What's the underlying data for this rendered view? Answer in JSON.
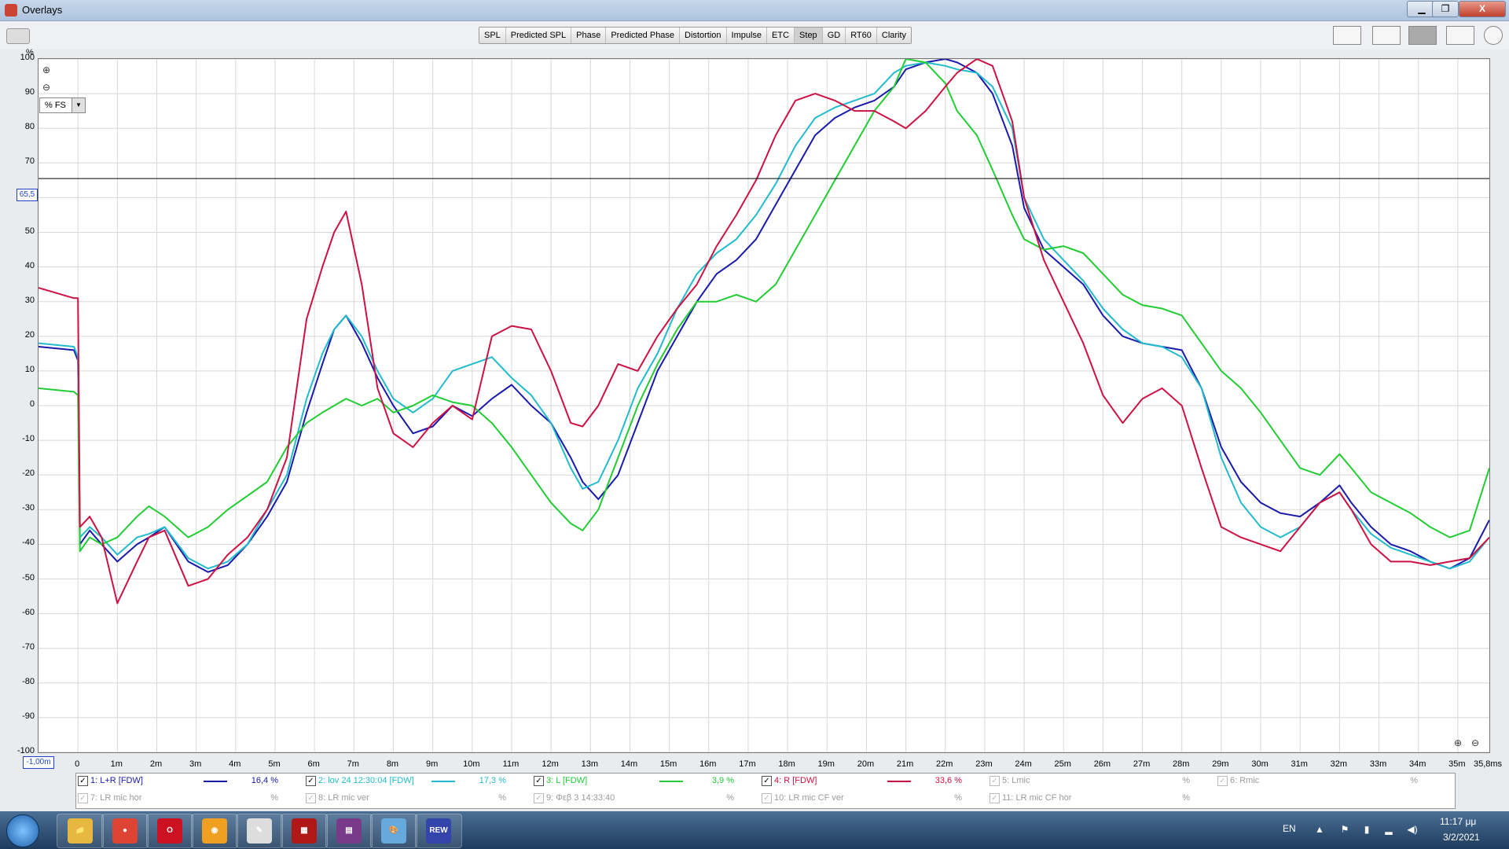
{
  "window": {
    "title": "Overlays",
    "minimize": "▁",
    "maximize": "❐",
    "close": "X"
  },
  "tabs": [
    {
      "label": "SPL",
      "active": false
    },
    {
      "label": "Predicted SPL",
      "active": false
    },
    {
      "label": "Phase",
      "active": false
    },
    {
      "label": "Predicted Phase",
      "active": false
    },
    {
      "label": "Distortion",
      "active": false
    },
    {
      "label": "Impulse",
      "active": false
    },
    {
      "label": "ETC",
      "active": false
    },
    {
      "label": "Step",
      "active": true
    },
    {
      "label": "GD",
      "active": false
    },
    {
      "label": "RT60",
      "active": false
    },
    {
      "label": "Clarity",
      "active": false
    }
  ],
  "plot": {
    "y_unit": "%",
    "scale_select": "% FS",
    "cursor_y": "65,5",
    "cursor_x": "-1,00m",
    "x_end_label": "35,8ms"
  },
  "chart_data": {
    "type": "line",
    "xlim": [
      -1,
      35.8
    ],
    "ylim": [
      -100,
      100
    ],
    "grid": true,
    "y_ticks": [
      100,
      90,
      80,
      70,
      60,
      50,
      40,
      30,
      20,
      10,
      0,
      -10,
      -20,
      -30,
      -40,
      -50,
      -60,
      -70,
      -80,
      -90,
      -100
    ],
    "x_ticks": [
      0,
      1,
      2,
      3,
      4,
      5,
      6,
      7,
      8,
      9,
      10,
      11,
      12,
      13,
      14,
      15,
      16,
      17,
      18,
      19,
      20,
      21,
      22,
      23,
      24,
      25,
      26,
      27,
      28,
      29,
      30,
      31,
      32,
      33,
      34,
      35
    ],
    "x_tick_labels": [
      "0",
      "1m",
      "2m",
      "3m",
      "4m",
      "5m",
      "6m",
      "7m",
      "8m",
      "9m",
      "10m",
      "11m",
      "12m",
      "13m",
      "14m",
      "15m",
      "16m",
      "17m",
      "18m",
      "19m",
      "20m",
      "21m",
      "22m",
      "23m",
      "24m",
      "25m",
      "26m",
      "27m",
      "28m",
      "29m",
      "30m",
      "31m",
      "32m",
      "33m",
      "34m",
      "35m"
    ],
    "cursor_line_y": 65.5,
    "series": [
      {
        "name": "1: L+R [FDW]",
        "color": "#1a1aaa",
        "x": [
          -1,
          -0.1,
          0,
          0.05,
          0.3,
          0.6,
          1,
          1.5,
          1.8,
          2.2,
          2.8,
          3.3,
          3.8,
          4.3,
          4.8,
          5.3,
          5.8,
          6.2,
          6.5,
          6.8,
          7.2,
          7.6,
          8,
          8.5,
          9,
          9.5,
          10,
          10.5,
          11,
          11.5,
          12,
          12.5,
          12.8,
          13.2,
          13.7,
          14.2,
          14.7,
          15.2,
          15.7,
          16.2,
          16.7,
          17.2,
          17.7,
          18.2,
          18.7,
          19.2,
          19.7,
          20.2,
          20.7,
          21,
          21.5,
          22,
          22.3,
          22.8,
          23.2,
          23.7,
          24,
          24.5,
          25,
          25.5,
          26,
          26.5,
          27,
          27.5,
          28,
          28.5,
          29,
          29.5,
          30,
          30.5,
          31,
          31.5,
          32,
          32.3,
          32.8,
          33.3,
          33.8,
          34.3,
          34.8,
          35.3,
          35.8
        ],
        "y": [
          17,
          16,
          13,
          -40,
          -36,
          -40,
          -45,
          -40,
          -38,
          -35,
          -45,
          -48,
          -46,
          -40,
          -32,
          -22,
          -2,
          12,
          22,
          26,
          18,
          8,
          0,
          -8,
          -6,
          0,
          -3,
          2,
          6,
          0,
          -5,
          -15,
          -22,
          -27,
          -20,
          -5,
          10,
          20,
          30,
          38,
          42,
          48,
          58,
          68,
          78,
          83,
          86,
          88,
          92,
          97,
          99,
          100,
          99,
          96,
          90,
          75,
          57,
          45,
          40,
          35,
          26,
          20,
          18,
          17,
          16,
          5,
          -12,
          -22,
          -28,
          -31,
          -32,
          -28,
          -23,
          -28,
          -35,
          -40,
          -42,
          -45,
          -47,
          -44,
          -33
        ]
      },
      {
        "name": "2: lov 24 12:30:04 [FDW]",
        "color": "#22bbcc",
        "x": [
          -1,
          -0.1,
          0,
          0.05,
          0.3,
          0.6,
          1,
          1.5,
          1.8,
          2.2,
          2.8,
          3.3,
          3.8,
          4.3,
          4.8,
          5.3,
          5.8,
          6.2,
          6.5,
          6.8,
          7.2,
          7.6,
          8,
          8.5,
          9,
          9.5,
          10,
          10.5,
          11,
          11.5,
          12,
          12.5,
          12.8,
          13.2,
          13.7,
          14.2,
          14.7,
          15.2,
          15.7,
          16.2,
          16.7,
          17.2,
          17.7,
          18.2,
          18.7,
          19.2,
          19.7,
          20.2,
          20.7,
          21,
          21.5,
          22,
          22.3,
          22.8,
          23.2,
          23.7,
          24,
          24.5,
          25,
          25.5,
          26,
          26.5,
          27,
          27.5,
          28,
          28.5,
          29,
          29.5,
          30,
          30.5,
          31,
          31.5,
          32,
          32.3,
          32.8,
          33.3,
          33.8,
          34.3,
          34.8,
          35.3,
          35.8
        ],
        "y": [
          18,
          17,
          14,
          -38,
          -35,
          -38,
          -43,
          -38,
          -37,
          -35,
          -44,
          -47,
          -45,
          -40,
          -30,
          -20,
          2,
          15,
          22,
          26,
          20,
          10,
          2,
          -2,
          2,
          10,
          12,
          14,
          8,
          3,
          -5,
          -18,
          -24,
          -22,
          -10,
          5,
          15,
          28,
          38,
          44,
          48,
          55,
          64,
          75,
          83,
          86,
          88,
          90,
          96,
          98,
          99,
          98,
          97,
          96,
          92,
          80,
          60,
          48,
          42,
          36,
          28,
          22,
          18,
          17,
          14,
          5,
          -15,
          -28,
          -35,
          -38,
          -35,
          -28,
          -25,
          -30,
          -37,
          -41,
          -43,
          -45,
          -47,
          -45,
          -38
        ]
      },
      {
        "name": "3: L [FDW]",
        "color": "#22cc33",
        "x": [
          -1,
          -0.1,
          0,
          0.05,
          0.3,
          0.6,
          1,
          1.5,
          1.8,
          2.2,
          2.8,
          3.3,
          3.8,
          4.3,
          4.8,
          5.3,
          5.8,
          6.2,
          6.5,
          6.8,
          7.2,
          7.6,
          8,
          8.5,
          9,
          9.5,
          10,
          10.5,
          11,
          11.5,
          12,
          12.5,
          12.8,
          13.2,
          13.7,
          14.2,
          14.7,
          15.2,
          15.7,
          16.2,
          16.7,
          17.2,
          17.7,
          18.2,
          18.7,
          19.2,
          19.7,
          20.2,
          20.7,
          21,
          21.5,
          22,
          22.3,
          22.8,
          23.2,
          23.7,
          24,
          24.5,
          25,
          25.5,
          26,
          26.5,
          27,
          27.5,
          28,
          28.5,
          29,
          29.5,
          30,
          30.5,
          31,
          31.5,
          32,
          32.3,
          32.8,
          33.3,
          33.8,
          34.3,
          34.8,
          35.3,
          35.8
        ],
        "y": [
          5,
          4,
          3,
          -42,
          -38,
          -40,
          -38,
          -32,
          -29,
          -32,
          -38,
          -35,
          -30,
          -26,
          -22,
          -12,
          -5,
          -2,
          0,
          2,
          0,
          2,
          -2,
          0,
          3,
          1,
          0,
          -5,
          -12,
          -20,
          -28,
          -34,
          -36,
          -30,
          -15,
          0,
          12,
          22,
          30,
          30,
          32,
          30,
          35,
          45,
          55,
          65,
          75,
          85,
          92,
          100,
          99,
          93,
          85,
          78,
          68,
          55,
          48,
          45,
          46,
          44,
          38,
          32,
          29,
          28,
          26,
          18,
          10,
          5,
          -2,
          -10,
          -18,
          -20,
          -14,
          -18,
          -25,
          -28,
          -31,
          -35,
          -38,
          -36,
          -18
        ]
      },
      {
        "name": "4: R [FDW]",
        "color": "#cc1144",
        "x": [
          -1,
          -0.1,
          0,
          0.05,
          0.3,
          0.6,
          1,
          1.5,
          1.8,
          2.2,
          2.8,
          3.3,
          3.8,
          4.3,
          4.8,
          5.3,
          5.8,
          6.2,
          6.5,
          6.8,
          7.2,
          7.6,
          8,
          8.5,
          9,
          9.5,
          10,
          10.5,
          11,
          11.5,
          12,
          12.5,
          12.8,
          13.2,
          13.7,
          14.2,
          14.7,
          15.2,
          15.7,
          16.2,
          16.7,
          17.2,
          17.7,
          18.2,
          18.7,
          19.2,
          19.7,
          20.2,
          20.7,
          21,
          21.5,
          22,
          22.3,
          22.8,
          23.2,
          23.7,
          24,
          24.5,
          25,
          25.5,
          26,
          26.5,
          27,
          27.5,
          28,
          28.5,
          29,
          29.5,
          30,
          30.5,
          31,
          31.5,
          32,
          32.3,
          32.8,
          33.3,
          33.8,
          34.3,
          34.8,
          35.3,
          35.8
        ],
        "y": [
          34,
          31,
          31,
          -35,
          -32,
          -38,
          -57,
          -45,
          -38,
          -36,
          -52,
          -50,
          -43,
          -38,
          -30,
          -15,
          25,
          40,
          50,
          56,
          35,
          5,
          -8,
          -12,
          -5,
          0,
          -4,
          20,
          23,
          22,
          10,
          -5,
          -6,
          0,
          12,
          10,
          20,
          28,
          35,
          46,
          55,
          65,
          78,
          88,
          90,
          88,
          85,
          85,
          82,
          80,
          85,
          92,
          96,
          100,
          98,
          82,
          60,
          42,
          30,
          18,
          3,
          -5,
          2,
          5,
          0,
          -18,
          -35,
          -38,
          -40,
          -42,
          -35,
          -28,
          -25,
          -30,
          -40,
          -45,
          -45,
          -46,
          -45,
          -44,
          -38
        ]
      }
    ]
  },
  "legend": [
    {
      "label": "1: L+R [FDW]",
      "value": "16,4 %",
      "checked": true,
      "color": "#1a1aaa",
      "enabled": true
    },
    {
      "label": "2: lov 24 12:30:04 [FDW]",
      "value": "17,3 %",
      "checked": true,
      "color": "#22bbcc",
      "enabled": true
    },
    {
      "label": "3: L [FDW]",
      "value": "3,9 %",
      "checked": true,
      "color": "#22cc33",
      "enabled": true
    },
    {
      "label": "4: R [FDW]",
      "value": "33,6 %",
      "checked": true,
      "color": "#cc1144",
      "enabled": true
    },
    {
      "label": "5: Lmic",
      "value": "%",
      "checked": true,
      "color": "",
      "enabled": false
    },
    {
      "label": "6: Rmic",
      "value": "%",
      "checked": true,
      "color": "",
      "enabled": false
    },
    {
      "label": "7: LR mic hor",
      "value": "%",
      "checked": true,
      "color": "",
      "enabled": false
    },
    {
      "label": "8: LR mic ver",
      "value": "%",
      "checked": true,
      "color": "",
      "enabled": false
    },
    {
      "label": "9: Φεβ 3 14:33:40",
      "value": "%",
      "checked": true,
      "color": "",
      "enabled": false
    },
    {
      "label": "10: LR mic CF ver",
      "value": "%",
      "checked": true,
      "color": "",
      "enabled": false
    },
    {
      "label": "11: LR mic CF hor",
      "value": "%",
      "checked": true,
      "color": "",
      "enabled": false
    }
  ],
  "taskbar": {
    "lang": "EN",
    "time": "11:17 μμ",
    "date": "3/2/2021",
    "apps": [
      {
        "name": "explorer",
        "glyph": "📁",
        "color": "#e6b840"
      },
      {
        "name": "chrome",
        "glyph": "●",
        "color": "#dd4433"
      },
      {
        "name": "opera",
        "glyph": "O",
        "color": "#cc1122"
      },
      {
        "name": "avast",
        "glyph": "◉",
        "color": "#f0a020"
      },
      {
        "name": "notepad",
        "glyph": "✎",
        "color": "#ddd"
      },
      {
        "name": "red-app",
        "glyph": "▦",
        "color": "#b01818"
      },
      {
        "name": "winrar",
        "glyph": "▤",
        "color": "#7a3a8a"
      },
      {
        "name": "paint",
        "glyph": "🎨",
        "color": "#66aadd"
      },
      {
        "name": "rew",
        "glyph": "REW",
        "color": "#3344aa"
      }
    ]
  }
}
